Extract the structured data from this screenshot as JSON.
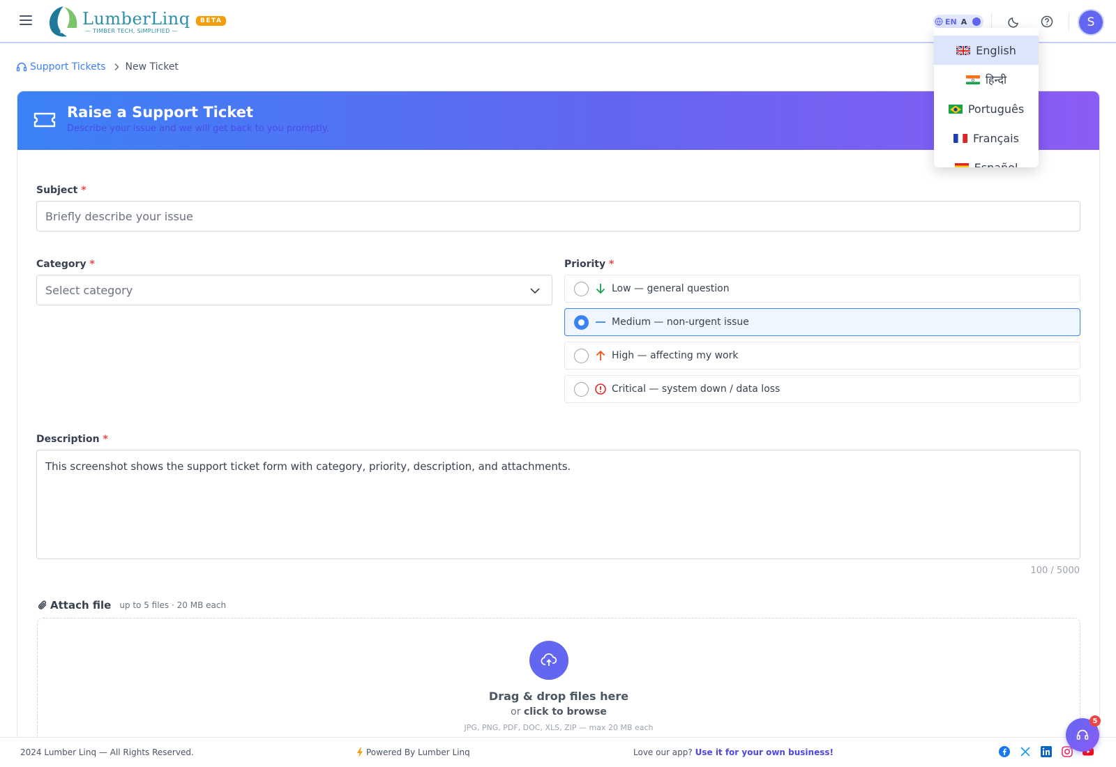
{
  "header": {
    "app_name": "LumberLinq",
    "tagline": "TIMBER TECH, SIMPLIFIED",
    "beta_badge": "BETA",
    "lang_toggle_code": "EN",
    "lang_toggle_alt": "A",
    "avatar_initial": "S",
    "colors": {
      "accent": "#6366f1",
      "brand": "#2a8fa8",
      "beta": "#f59e0b"
    }
  },
  "language_menu": {
    "items": [
      {
        "label": "English",
        "flag": "uk-flag",
        "active": true
      },
      {
        "label": "हिन्दी",
        "flag": "india-flag",
        "active": false
      },
      {
        "label": "Português",
        "flag": "brazil-flag",
        "active": false
      },
      {
        "label": "Français",
        "flag": "france-flag",
        "active": false
      },
      {
        "label": "Español",
        "flag": "spain-flag",
        "active": false
      }
    ]
  },
  "breadcrumb": {
    "parent": "Support Tickets",
    "current": "New Ticket"
  },
  "form": {
    "title": "Raise a Support Ticket",
    "subtitle": "Describe your issue and we will get back to you promptly.",
    "subject": {
      "label": "Subject",
      "required": "*",
      "placeholder": "Briefly describe your issue",
      "value": ""
    },
    "category": {
      "label": "Category",
      "required": "*",
      "selected": "Select category"
    },
    "priority": {
      "label": "Priority",
      "required": "*",
      "options": [
        {
          "label": "Low — general question",
          "icon": "arrow-down-icon",
          "color": "#16a34a",
          "selected": false
        },
        {
          "label": "Medium — non-urgent issue",
          "icon": "dash-icon",
          "color": "#3b82f6",
          "selected": true
        },
        {
          "label": "High — affecting my work",
          "icon": "arrow-up-icon",
          "color": "#ea580c",
          "selected": false
        },
        {
          "label": "Critical — system down / data loss",
          "icon": "alert-circle-icon",
          "color": "#dc2626",
          "selected": false
        }
      ]
    },
    "description": {
      "label": "Description",
      "required": "*",
      "value": "This screenshot shows the support ticket form with category, priority, description, and attachments.",
      "counter": "100 / 5000"
    },
    "attach": {
      "label": "Attach file",
      "hint": "up to 5 files · 20 MB each",
      "drop_title": "Drag & drop files here",
      "drop_or": "or",
      "drop_browse": "click to browse",
      "file_types": "JPG, PNG, PDF, DOC, XLS, ZIP — max 20 MB each"
    }
  },
  "footer": {
    "copyright": "2024 Lumber Linq — All Rights Reserved.",
    "powered": "Powered By Lumber Linq",
    "love_text": "Love our app?",
    "love_link": "Use it for your own business!",
    "social": [
      "facebook-icon",
      "x-icon",
      "linkedin-icon",
      "instagram-icon",
      "youtube-icon"
    ]
  },
  "help_fab": {
    "badge": "5"
  }
}
